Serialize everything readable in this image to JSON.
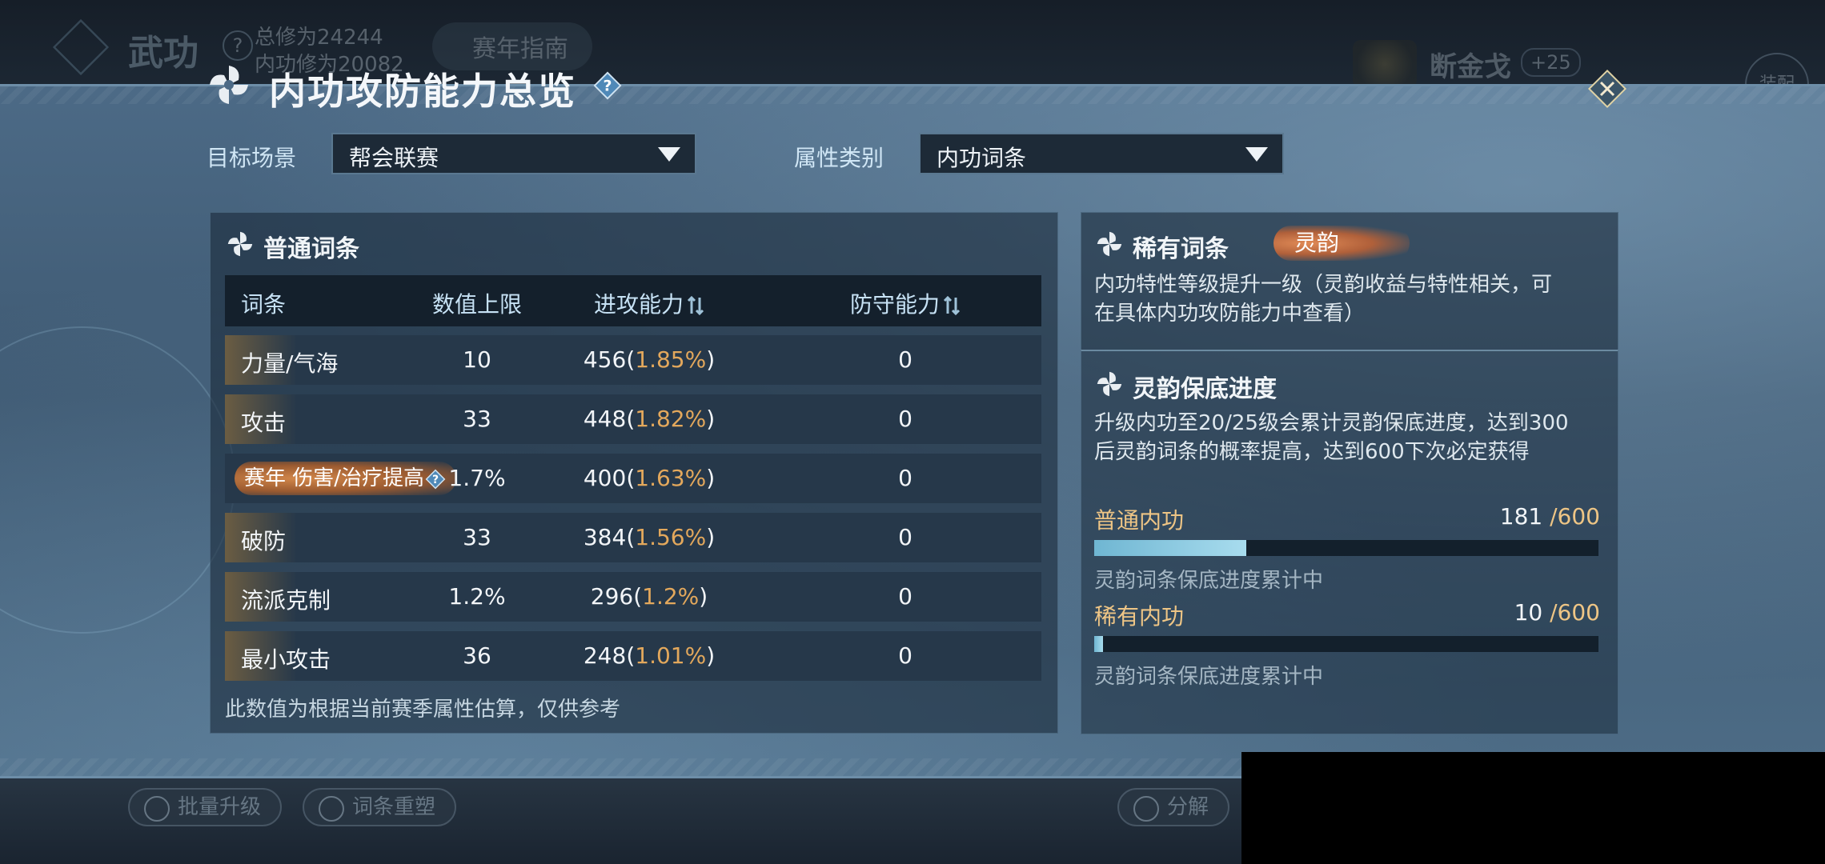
{
  "background": {
    "title": "武功",
    "stat_total": "总修为24244",
    "stat_inner": "内功修为20082",
    "guide": "赛年指南",
    "weapon_name": "断金戈",
    "weapon_plus": "+25",
    "equip": "装配",
    "batch_upgrade": "批量升级",
    "reshape": "词条重塑",
    "decompose": "分解"
  },
  "header": {
    "title": "内功攻防能力总览",
    "help": "?"
  },
  "filters": {
    "scene_label": "目标场景",
    "scene_value": "帮会联赛",
    "attr_label": "属性类别",
    "attr_value": "内功词条"
  },
  "common": {
    "title": "普通词条",
    "columns": [
      "词条",
      "数值上限",
      "进攻能力",
      "防守能力"
    ],
    "rows": [
      {
        "name": "力量/气海",
        "max": "10",
        "atk": "456",
        "atk_pct": "1.85%",
        "def": "0"
      },
      {
        "name": "攻击",
        "max": "33",
        "atk": "448",
        "atk_pct": "1.82%",
        "def": "0"
      },
      {
        "badge": "赛年",
        "name": "伤害/治疗提高",
        "max": "1.7%",
        "atk": "400",
        "atk_pct": "1.63%",
        "def": "0"
      },
      {
        "name": "破防",
        "max": "33",
        "atk": "384",
        "atk_pct": "1.56%",
        "def": "0"
      },
      {
        "name": "流派克制",
        "max": "1.2%",
        "atk": "296",
        "atk_pct": "1.2%",
        "def": "0"
      },
      {
        "name": "最小攻击",
        "max": "36",
        "atk": "248",
        "atk_pct": "1.01%",
        "def": "0"
      }
    ],
    "footnote": "此数值为根据当前赛季属性估算，仅供参考"
  },
  "rare": {
    "title": "稀有词条",
    "badge": "灵韵",
    "desc_line1": "内功特性等级提升一级（灵韵收益与特性相关，可",
    "desc_line2": "在具体内功攻防能力中查看）"
  },
  "pity": {
    "title": "灵韵保底进度",
    "desc_line1": "升级内功至20/25级会累计灵韵保底进度，达到300",
    "desc_line2": "后灵韵词条的概率提高，达到600下次必定获得",
    "common": {
      "label": "普通内功",
      "value": "181",
      "max": "/600",
      "progress": 0.3017,
      "note": "灵韵词条保底进度累计中"
    },
    "rare": {
      "label": "稀有内功",
      "value": "10",
      "max": "/600",
      "progress": 0.0167,
      "note": "灵韵词条保底进度累计中"
    }
  },
  "colors": {
    "accent_orange": "#e3a85c",
    "label_gold": "#eec585",
    "progress_blue": "#8ccbe3"
  }
}
